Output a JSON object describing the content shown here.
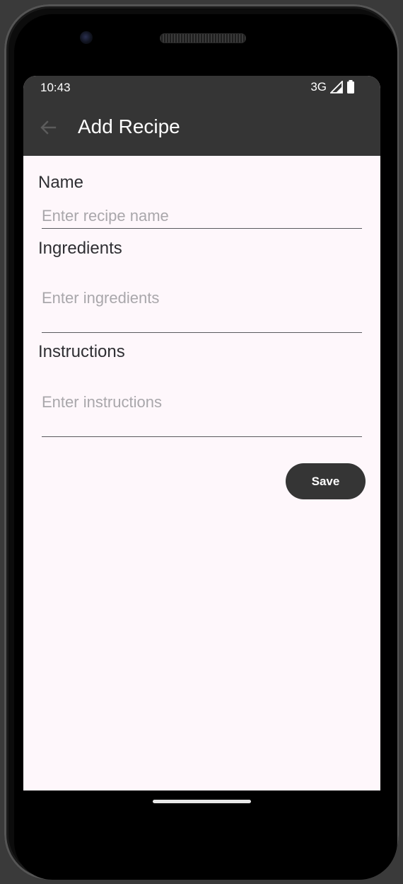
{
  "status_bar": {
    "time": "10:43",
    "network": "3G",
    "signal_icon": "signal-icon",
    "battery_icon": "battery-icon"
  },
  "app_bar": {
    "title": "Add Recipe",
    "back_icon": "arrow-back-icon"
  },
  "form": {
    "name": {
      "label": "Name",
      "placeholder": "Enter recipe name",
      "value": ""
    },
    "ingredients": {
      "label": "Ingredients",
      "placeholder": "Enter ingredients",
      "value": ""
    },
    "instructions": {
      "label": "Instructions",
      "placeholder": "Enter instructions",
      "value": ""
    },
    "save_label": "Save"
  },
  "colors": {
    "app_bar": "#353535",
    "background": "#fef7fb",
    "button": "#353535",
    "placeholder": "#a9a7ab"
  }
}
